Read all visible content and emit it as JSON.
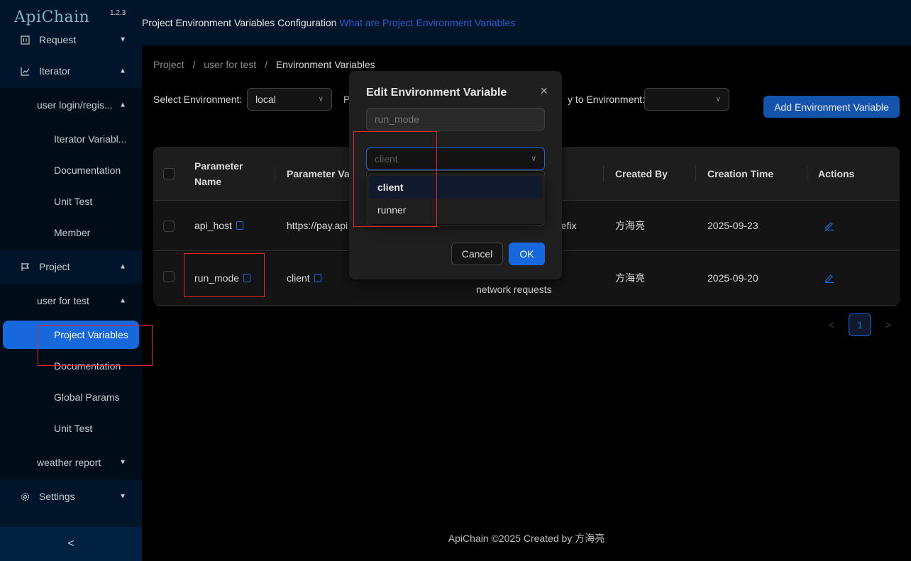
{
  "app": {
    "name": "ApiChain",
    "version": "1.2.3"
  },
  "sidebar": {
    "items": [
      {
        "label": "Request",
        "icon": "layout-icon",
        "chevron": "down"
      },
      {
        "label": "Iterator",
        "icon": "line-chart-icon",
        "chevron": "up"
      },
      {
        "label": "user login/regis...",
        "chevron": "up"
      },
      {
        "label": "Iterator Variabl..."
      },
      {
        "label": "Documentation"
      },
      {
        "label": "Unit Test"
      },
      {
        "label": "Member"
      },
      {
        "label": "Project",
        "icon": "flag-icon",
        "chevron": "up"
      },
      {
        "label": "user for test",
        "chevron": "up"
      },
      {
        "label": "Project Variables",
        "selected": true
      },
      {
        "label": "Documentation"
      },
      {
        "label": "Global Params"
      },
      {
        "label": "Unit Test"
      },
      {
        "label": "weather report",
        "chevron": "down"
      },
      {
        "label": "Settings",
        "icon": "gear-icon",
        "chevron": "down"
      }
    ],
    "collapse_icon": "<"
  },
  "header": {
    "title": "Project Environment Variables Configuration",
    "link": "What are Project Environment Variables"
  },
  "breadcrumb": {
    "items": [
      "Project",
      "user for test",
      "Environment Variables"
    ],
    "separator": "/"
  },
  "filters": {
    "env_label": "Select Environment:",
    "env_value": "local",
    "project_label_fragment": "P",
    "copy_label_fragment": "y to Environment:",
    "copy_value": "",
    "add_button": "Add Environment Variable"
  },
  "table": {
    "columns": [
      "Parameter Name",
      "Parameter Val",
      "Created By",
      "Creation Time",
      "Actions"
    ],
    "column_name_line1": "Parameter",
    "column_name_line2": "Name",
    "rows": [
      {
        "name": "api_host",
        "value": "https://pay.api",
        "remark": "refix",
        "created_by": "方海亮",
        "created_at": "2025-09-23"
      },
      {
        "name": "run_mode",
        "value": "client",
        "remark": "network requests",
        "created_by": "方海亮",
        "created_at": "2025-09-20"
      }
    ]
  },
  "pagination": {
    "prev": "<",
    "current": "1",
    "next": ">"
  },
  "footer": "ApiChain ©2025 Created by 方海亮",
  "modal": {
    "title": "Edit Environment Variable",
    "close": "×",
    "name_placeholder": "run_mode",
    "select_placeholder": "client",
    "options": [
      "client",
      "runner"
    ],
    "selected_option": "client",
    "cancel": "Cancel",
    "ok": "OK"
  },
  "colors": {
    "primary": "#1668dc",
    "sidebar": "#001529",
    "annotation": "#e0262b"
  }
}
